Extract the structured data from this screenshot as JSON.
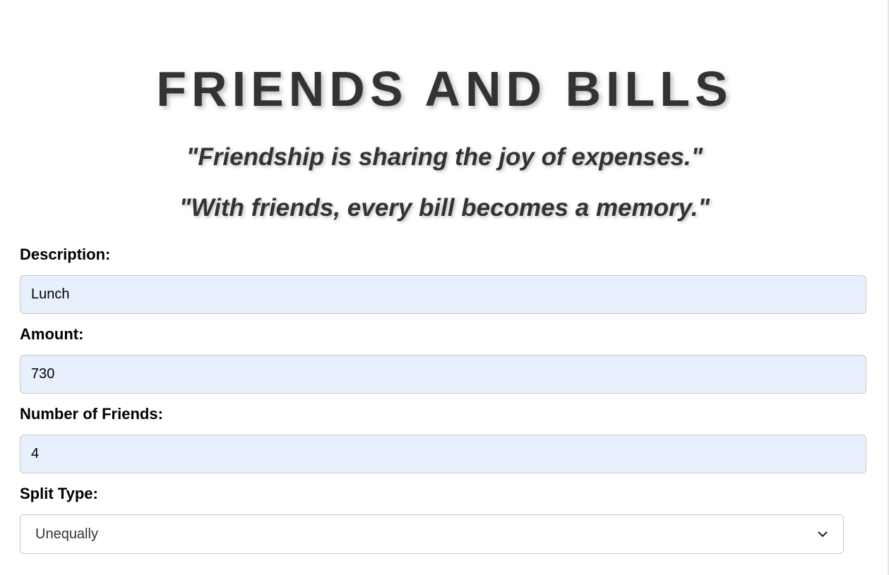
{
  "header": {
    "title": "FRIENDS AND BILLS",
    "quotes": [
      "\"Friendship is sharing the joy of expenses.\"",
      "\"With friends, every bill becomes a memory.\""
    ]
  },
  "form": {
    "description": {
      "label": "Description:",
      "value": "Lunch"
    },
    "amount": {
      "label": "Amount:",
      "value": "730"
    },
    "friends": {
      "label": "Number of Friends:",
      "value": "4"
    },
    "split_type": {
      "label": "Split Type:",
      "value": "Unequally",
      "icon": "chevron-down-icon"
    }
  },
  "colors": {
    "title": "#333333",
    "input_bg": "#e8f0fe",
    "border": "#c8c8c8"
  }
}
